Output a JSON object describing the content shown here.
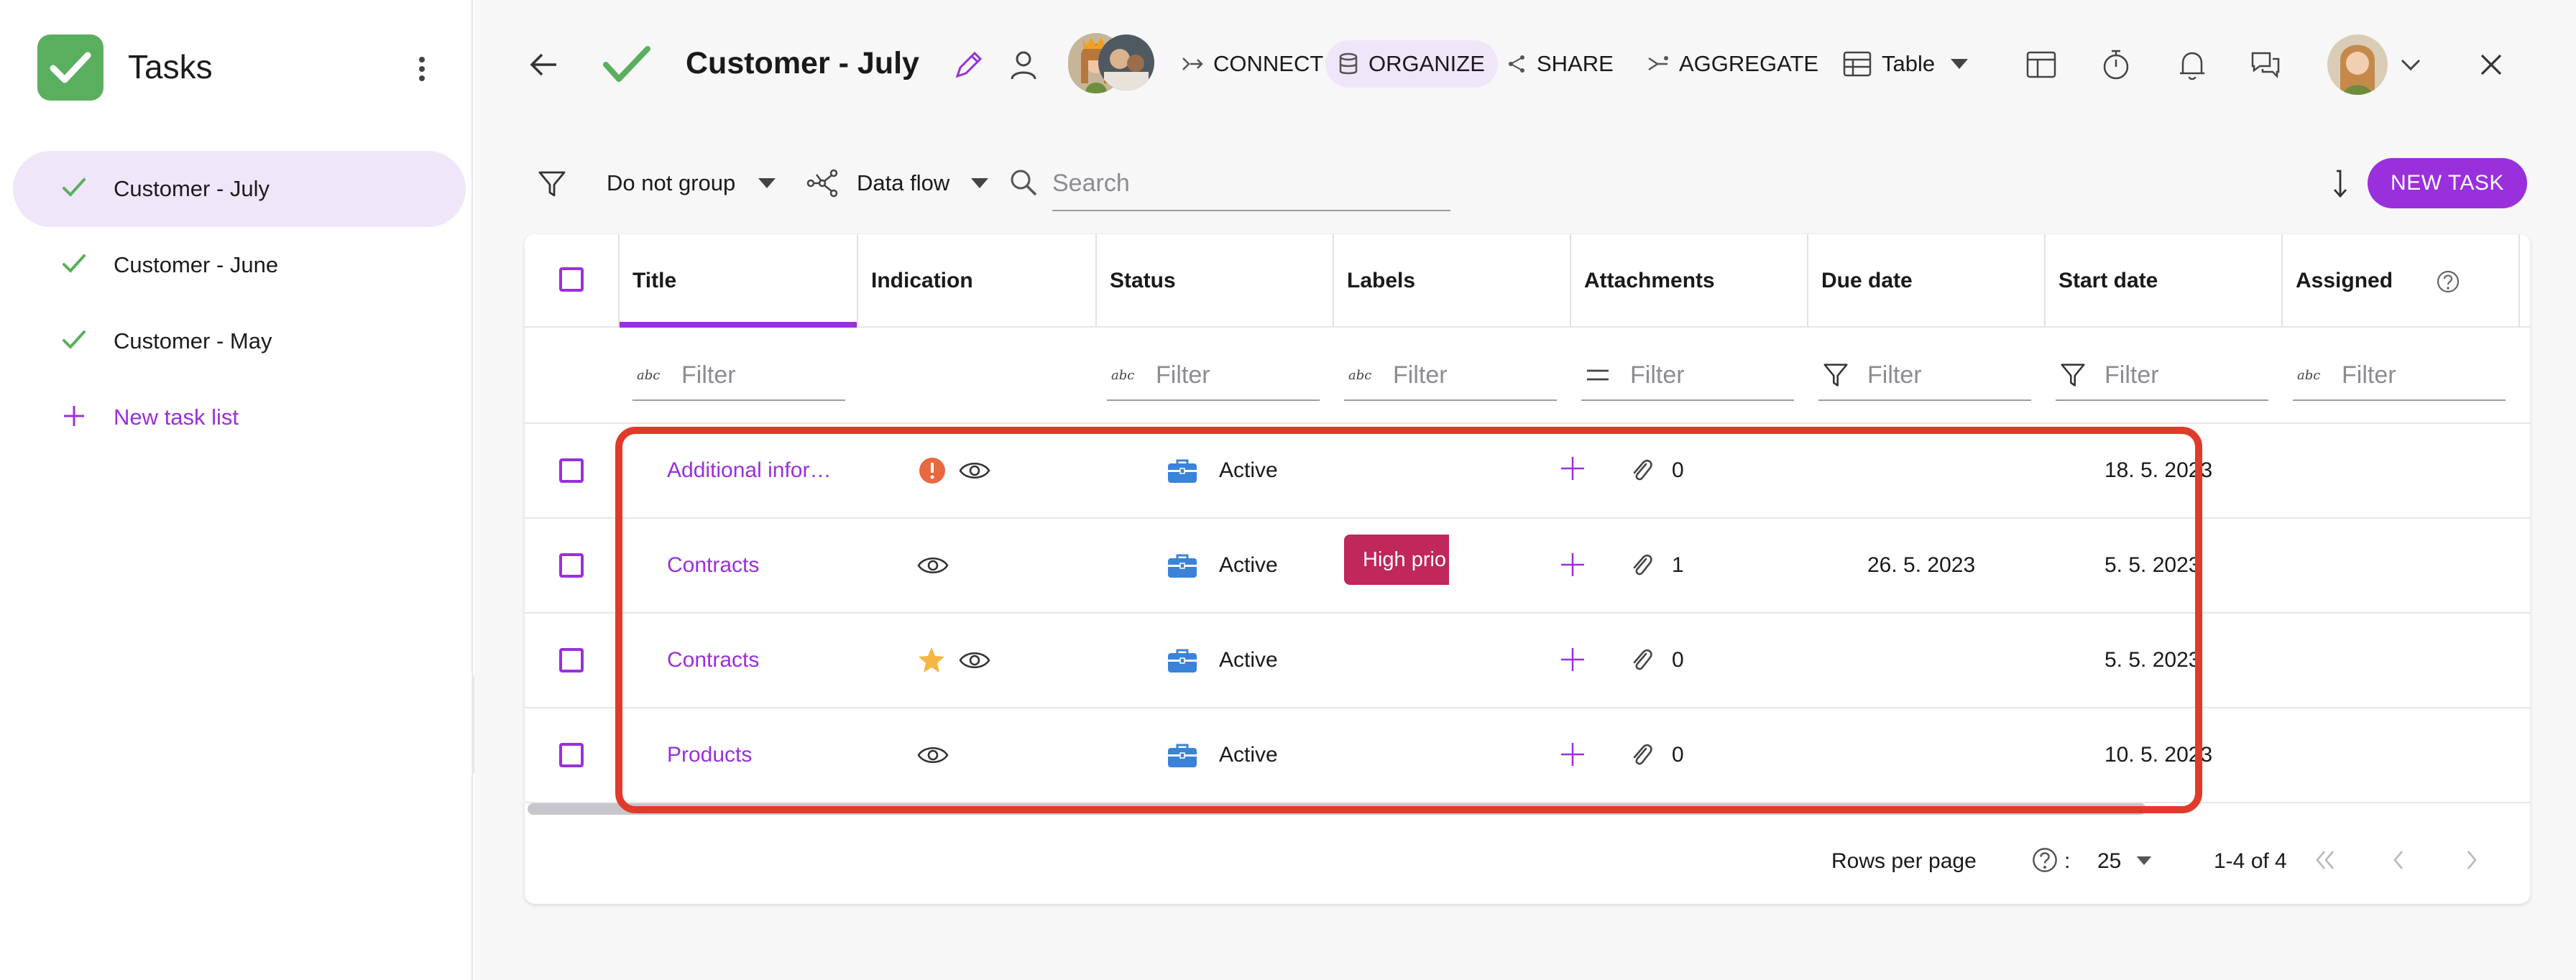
{
  "sidebar": {
    "app_title": "Tasks",
    "items": [
      {
        "label": "Customer - July",
        "active": true
      },
      {
        "label": "Customer - June",
        "active": false
      },
      {
        "label": "Customer - May",
        "active": false
      }
    ],
    "new_list_label": "New task list"
  },
  "header": {
    "title": "Customer - July",
    "actions": {
      "connect": "CONNECT",
      "organize": "ORGANIZE",
      "share": "SHARE",
      "aggregate": "AGGREGATE"
    },
    "view_selector": "Table"
  },
  "toolbar": {
    "group_by": "Do not group",
    "data_flow": "Data flow",
    "search_placeholder": "Search",
    "new_task": "NEW TASK"
  },
  "table": {
    "columns": [
      "Title",
      "Indication",
      "Status",
      "Labels",
      "Attachments",
      "Due date",
      "Start date",
      "Assigned"
    ],
    "filter_placeholder": "Filter",
    "rows": [
      {
        "title": "Additional infor…",
        "indication": [
          "alert",
          "watch"
        ],
        "status": "Active",
        "label": "",
        "attachments": "0",
        "due": "",
        "start": "18. 5. 2023"
      },
      {
        "title": "Contracts",
        "indication": [
          "watch"
        ],
        "status": "Active",
        "label": "High prio",
        "attachments": "1",
        "due": "26. 5. 2023",
        "start": "5. 5. 2023"
      },
      {
        "title": "Contracts",
        "indication": [
          "star",
          "watch"
        ],
        "status": "Active",
        "label": "",
        "attachments": "0",
        "due": "",
        "start": "5. 5. 2023"
      },
      {
        "title": "Products",
        "indication": [
          "watch"
        ],
        "status": "Active",
        "label": "",
        "attachments": "0",
        "due": "",
        "start": "10. 5. 2023"
      }
    ]
  },
  "pagination": {
    "rows_per_page_label": "Rows per page",
    "rows_per_page_value": "25",
    "range": "1-4 of 4"
  },
  "colors": {
    "accent": "#9a2fdc",
    "label_high_prio": "#c0275a",
    "highlight": "#e23a2a",
    "status_icon": "#3b82d9",
    "logo_green": "#5aaf5e"
  }
}
